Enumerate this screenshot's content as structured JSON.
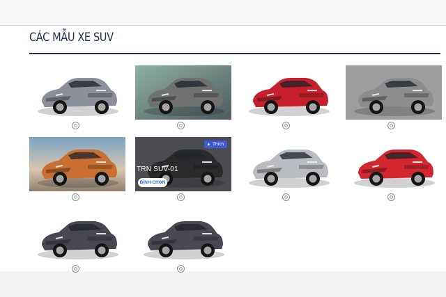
{
  "section": {
    "title": "CÁC MẪU XE SUV"
  },
  "overlay": {
    "model_label": "TRN SUV-01",
    "vote_label": "BÌNH CHỌN",
    "like_label": "Thích",
    "like_icon": "thumbs-up-icon"
  },
  "colors": {
    "heading": "#1f2f4d",
    "like_button": "#3b5bd9",
    "vote_text": "#2a6fdb"
  },
  "cars": [
    {
      "body_color": "#8a8f99",
      "background": "white",
      "selected": false
    },
    {
      "body_color": "#6f7270",
      "background": "gradient",
      "selected": false
    },
    {
      "body_color": "#c7202a",
      "background": "white",
      "selected": false
    },
    {
      "body_color": "#8b8c8e",
      "background": "dark-gray",
      "selected": false
    },
    {
      "body_color": "#c96f31",
      "background": "landscape",
      "selected": false
    },
    {
      "body_color": "#2a2a2d",
      "background": "gray-overlay",
      "selected": false
    },
    {
      "body_color": "#b9bcc1",
      "background": "white",
      "selected": false
    },
    {
      "body_color": "#d3262e",
      "background": "white",
      "selected": false
    },
    {
      "body_color": "#4a4753",
      "background": "white",
      "selected": false
    },
    {
      "body_color": "#4b4854",
      "background": "white",
      "selected": false
    }
  ]
}
